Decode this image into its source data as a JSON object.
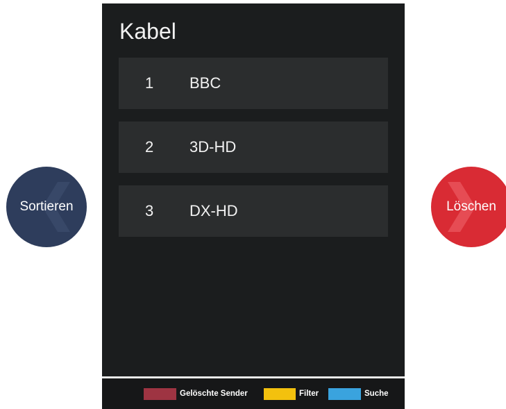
{
  "panel": {
    "title": "Kabel"
  },
  "channels": [
    {
      "number": "1",
      "name": "BBC"
    },
    {
      "number": "2",
      "name": "3D-HD"
    },
    {
      "number": "3",
      "name": "DX-HD"
    }
  ],
  "side_buttons": {
    "sort": {
      "label": "Sortieren",
      "color": "#2e3d5c",
      "icon": "chevron-left-icon"
    },
    "delete": {
      "label": "Löschen",
      "color": "#d92b34",
      "icon": "chevron-right-icon"
    }
  },
  "legend": [
    {
      "label": "Gelöschte Sender",
      "color": "#9e3442"
    },
    {
      "label": "Filter",
      "color": "#f3c10e"
    },
    {
      "label": "Suche",
      "color": "#3aa3de"
    }
  ],
  "colors": {
    "panel_background": "#1b1d1e",
    "row_background": "#2b2d2e",
    "text": "#f2f2f2"
  }
}
